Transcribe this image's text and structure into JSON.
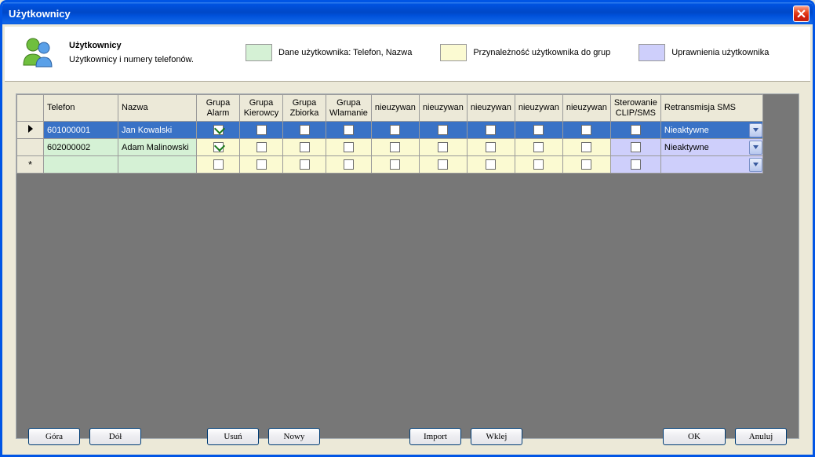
{
  "window": {
    "title": "Użytkownicy"
  },
  "header": {
    "title": "Użytkownicy",
    "subtitle": "Użytkownicy i numery telefonów."
  },
  "legend": {
    "green": "Dane użytkownika: Telefon, Nazwa",
    "yellow": "Przynależność użytkownika do grup",
    "purple": "Uprawnienia użytkownika"
  },
  "colors": {
    "green": "#d5f1d5",
    "yellow": "#fbfad2",
    "purple": "#cecffb",
    "selected": "#3972c6"
  },
  "columns": {
    "telefon": "Telefon",
    "nazwa": "Nazwa",
    "g_alarm_l1": "Grupa",
    "g_alarm_l2": "Alarm",
    "g_kier_l1": "Grupa",
    "g_kier_l2": "Kierowcy",
    "g_zbior_l1": "Grupa",
    "g_zbior_l2": "Zbiorka",
    "g_wlam_l1": "Grupa",
    "g_wlam_l2": "Wlamanie",
    "unused": "nieuzywan",
    "ster_l1": "Sterowanie",
    "ster_l2": "CLIP/SMS",
    "retr": "Retransmisja SMS"
  },
  "rows": [
    {
      "selected": true,
      "marker": "pointer",
      "telefon": "601000001",
      "nazwa": "Jan Kowalski",
      "groups": [
        true,
        false,
        false,
        false,
        false,
        false,
        false,
        false,
        false
      ],
      "clip": false,
      "retr": "Nieaktywne"
    },
    {
      "selected": false,
      "marker": "",
      "telefon": "602000002",
      "nazwa": "Adam Malinowski",
      "groups": [
        true,
        false,
        false,
        false,
        false,
        false,
        false,
        false,
        false
      ],
      "clip": false,
      "retr": "Nieaktywne"
    },
    {
      "selected": false,
      "marker": "star",
      "telefon": "",
      "nazwa": "",
      "groups": [
        false,
        false,
        false,
        false,
        false,
        false,
        false,
        false,
        false
      ],
      "clip": false,
      "retr": ""
    }
  ],
  "buttons": {
    "up": "Góra",
    "down": "Dół",
    "delete": "Usuń",
    "new": "Nowy",
    "import": "Import",
    "paste": "Wklej",
    "ok": "OK",
    "cancel": "Anuluj"
  }
}
